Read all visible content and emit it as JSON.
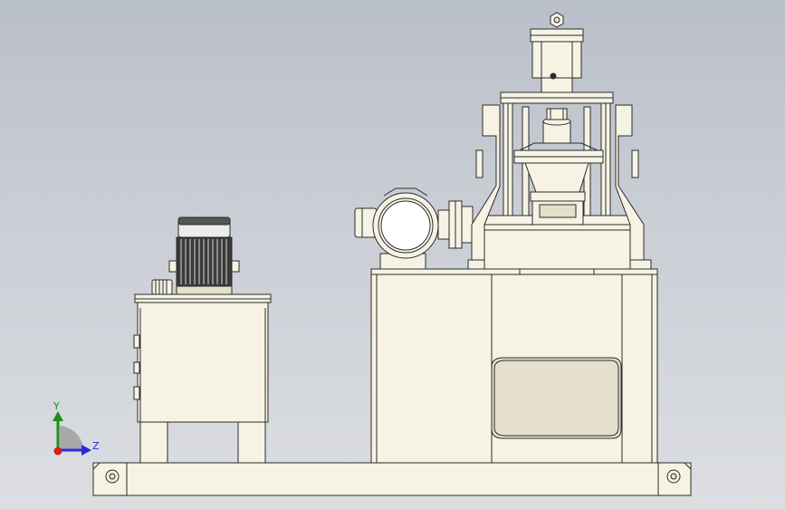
{
  "colors": {
    "part_fill": "#f6f3e4",
    "part_shade": "#e4e0cc",
    "edge": "#2b2b2b",
    "motor_dark": "#3a3a3a",
    "axis_y": "#1a8f1a",
    "axis_z": "#2a2ad8",
    "axis_origin": "#d42020"
  },
  "axis_triad": {
    "y_label": "Y",
    "z_label": "Z"
  }
}
